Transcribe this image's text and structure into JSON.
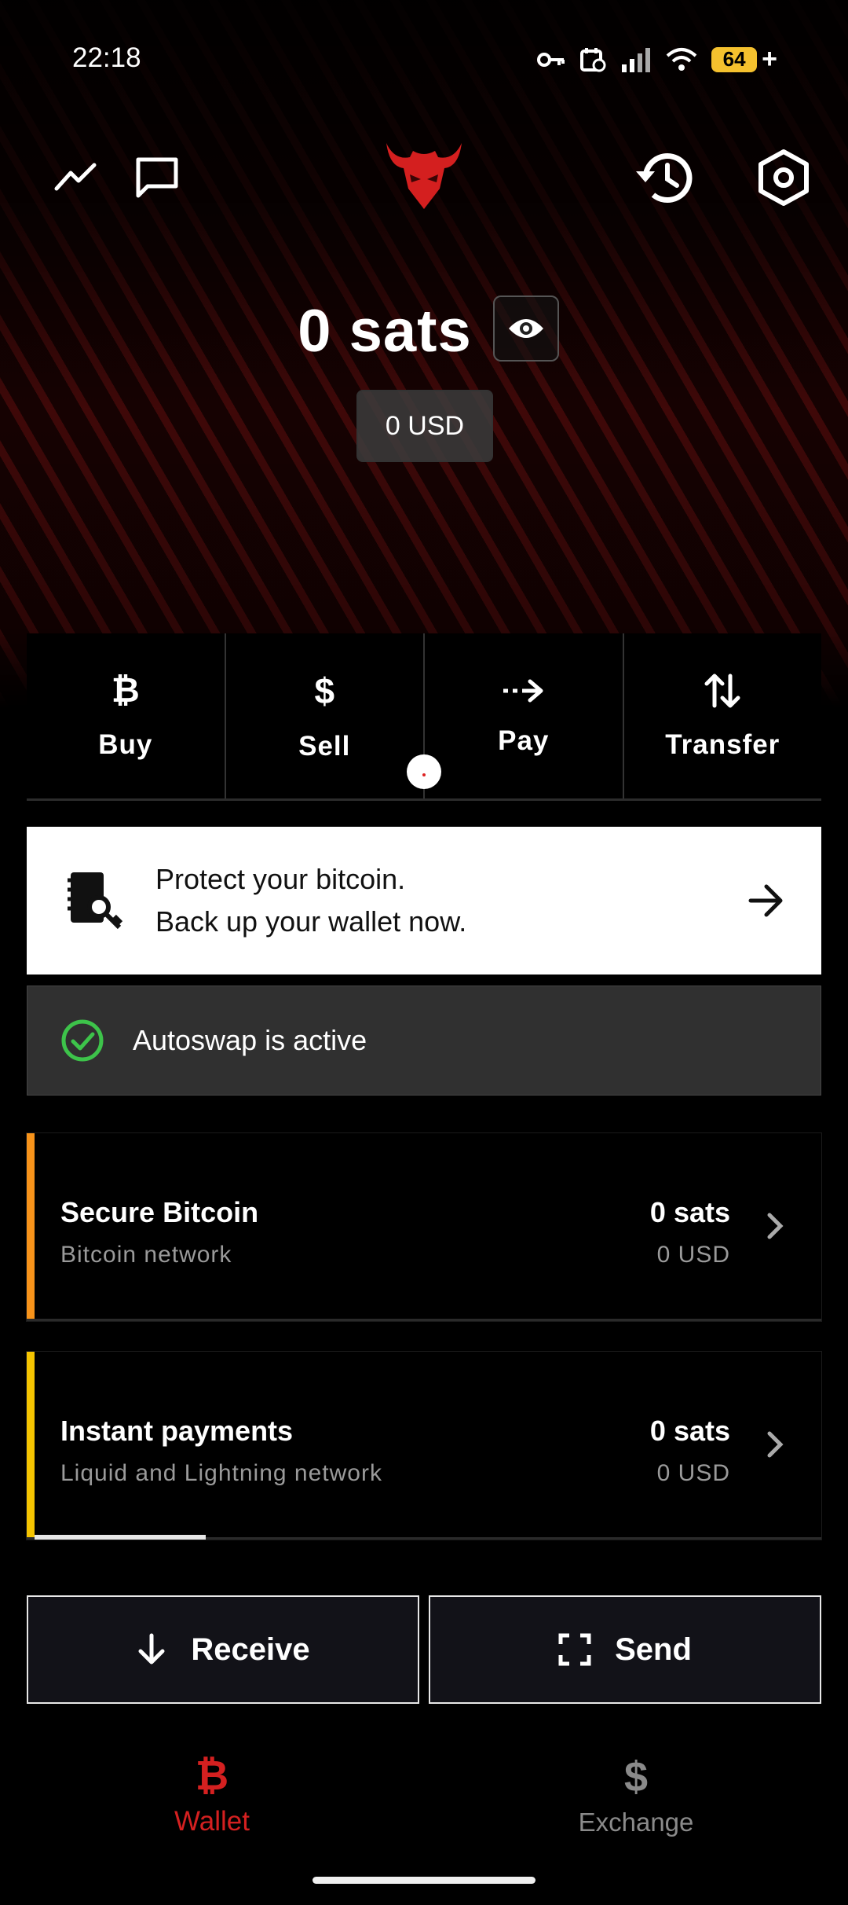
{
  "status_bar": {
    "time": "22:18",
    "battery": "64"
  },
  "balance": {
    "sats": "0 sats",
    "fiat": "0 USD"
  },
  "actions": [
    {
      "label": "Buy",
      "icon": "bitcoin-icon"
    },
    {
      "label": "Sell",
      "icon": "dollar-icon"
    },
    {
      "label": "Pay",
      "icon": "dashed-arrow-right-icon"
    },
    {
      "label": "Transfer",
      "icon": "arrows-up-down-icon"
    }
  ],
  "backup_banner": {
    "line1": "Protect your bitcoin.",
    "line2": "Back up your wallet now."
  },
  "autoswap": {
    "text": "Autoswap is active"
  },
  "wallets": [
    {
      "title": "Secure Bitcoin",
      "subtitle": "Bitcoin network",
      "sats": "0 sats",
      "fiat": "0 USD",
      "accent": "#f7931a"
    },
    {
      "title": "Instant payments",
      "subtitle": "Liquid and Lightning network",
      "sats": "0 sats",
      "fiat": "0 USD",
      "accent": "#f5c400"
    }
  ],
  "buttons": {
    "receive": "Receive",
    "send": "Send"
  },
  "nav": {
    "wallet": "Wallet",
    "exchange": "Exchange",
    "active_color": "#d42020"
  }
}
